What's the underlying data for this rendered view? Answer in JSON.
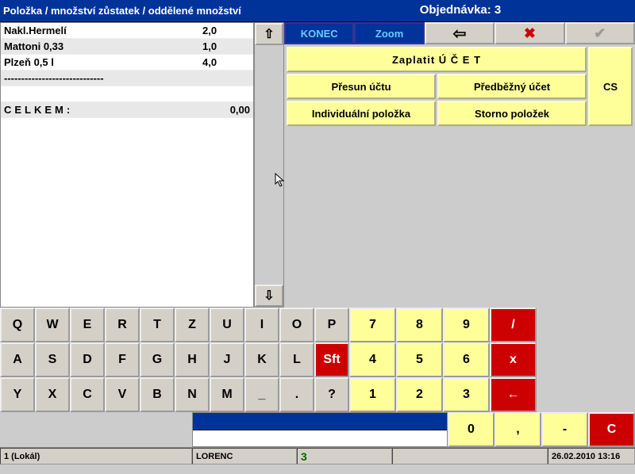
{
  "header": {
    "left": "Položka / množství zůstatek / oddělené množství",
    "order_label": "Objednávka: 3"
  },
  "items": [
    {
      "name": "Nakl.Hermelí",
      "qty": "2,0"
    },
    {
      "name": "Mattoni 0,33",
      "qty": "1,0"
    },
    {
      "name": "Plzeň 0,5 l",
      "qty": "4,0"
    }
  ],
  "separator": "-----------------------------",
  "total": {
    "label": "CELKEM:",
    "value": "0,00"
  },
  "topbar": {
    "konec": "KONEC",
    "zoom": "Zoom"
  },
  "actions": {
    "pay": "Zaplatit  Ú Č E T",
    "move": "Přesun účtu",
    "preliminary": "Předběžný účet",
    "individual": "Individuální položka",
    "storno": "Storno položek",
    "side": "CS"
  },
  "kb_rows_alpha": [
    [
      "Q",
      "W",
      "E",
      "R",
      "T",
      "Z",
      "U",
      "I",
      "O",
      "P"
    ],
    [
      "A",
      "S",
      "D",
      "F",
      "G",
      "H",
      "J",
      "K",
      "L",
      "Sft"
    ],
    [
      "Y",
      "X",
      "C",
      "V",
      "B",
      "N",
      "M",
      "_",
      ".",
      "?"
    ]
  ],
  "kb_num": [
    [
      "7",
      "8",
      "9",
      "/"
    ],
    [
      "4",
      "5",
      "6",
      "x"
    ],
    [
      "1",
      "2",
      "3",
      "←"
    ],
    [
      "0",
      ",",
      "-",
      "C"
    ]
  ],
  "status": {
    "lokal": "1 (Lokál)",
    "user": "LORENC",
    "pos": "3",
    "datetime": "26.02.2010 13:16"
  },
  "arrows": {
    "up": "⇧",
    "down": "⇩",
    "back": "⇦"
  }
}
